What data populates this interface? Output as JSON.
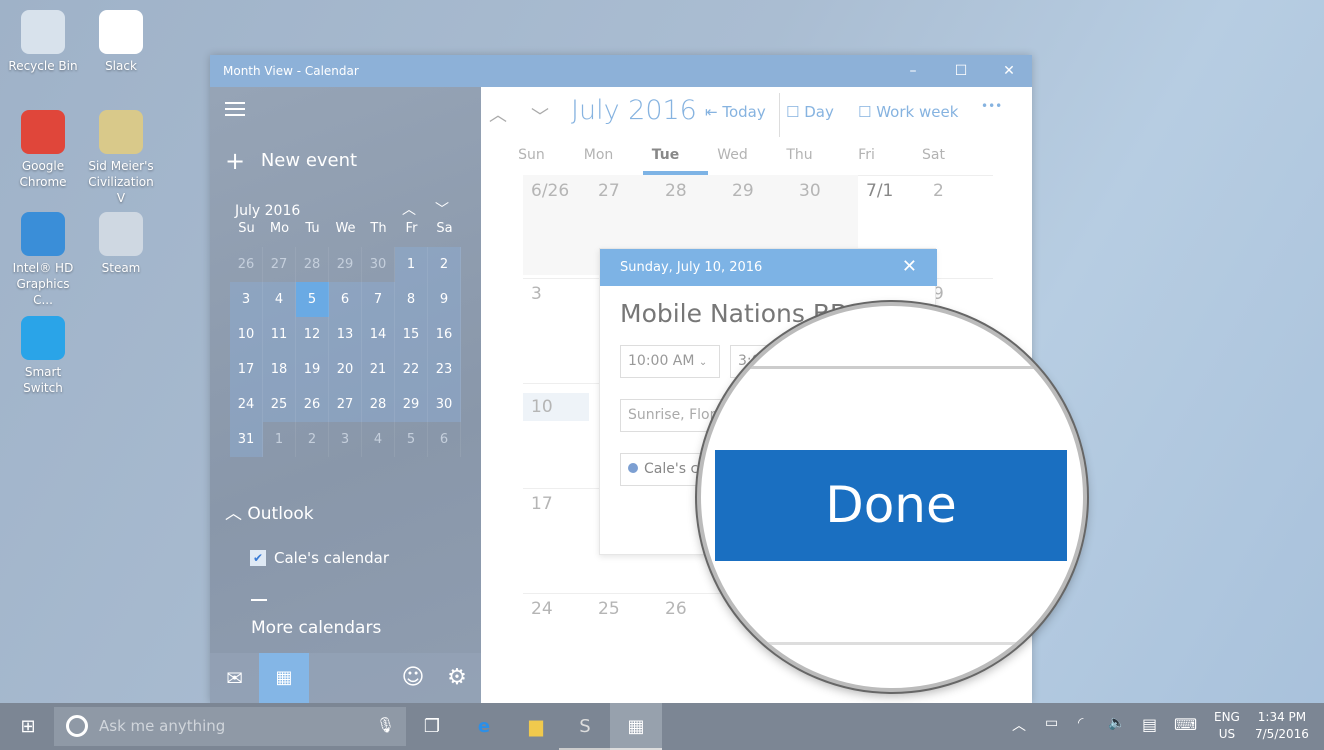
{
  "desktop": {
    "icons": [
      {
        "label": "Recycle Bin",
        "icon": "recycle-bin-icon",
        "color": "#d8e2ec"
      },
      {
        "label": "Slack",
        "icon": "slack-icon",
        "color": "#ffffff"
      },
      {
        "label": "Google Chrome",
        "icon": "chrome-icon",
        "color": "#e0463a"
      },
      {
        "label": "Sid Meier's Civilization V",
        "icon": "civilization-icon",
        "color": "#d9c98a"
      },
      {
        "label": "Intel® HD Graphics C...",
        "icon": "intel-icon",
        "color": "#3a8ed8"
      },
      {
        "label": "Steam",
        "icon": "steam-icon",
        "color": "#cfd8e2"
      },
      {
        "label": "Smart Switch",
        "icon": "smart-switch-icon",
        "color": "#2aa4e8"
      }
    ]
  },
  "window": {
    "title": "Month View - Calendar",
    "minimize": "–",
    "maximize": "☐",
    "close": "✕"
  },
  "sidebar": {
    "menu_icon": "hamburger-icon",
    "new_event": "New event",
    "mini_month": "July 2016",
    "weekdays": [
      "Su",
      "Mo",
      "Tu",
      "We",
      "Th",
      "Fr",
      "Sa"
    ],
    "weeks": [
      [
        "26",
        "27",
        "28",
        "29",
        "30",
        "1",
        "2"
      ],
      [
        "3",
        "4",
        "5",
        "6",
        "7",
        "8",
        "9"
      ],
      [
        "10",
        "11",
        "12",
        "13",
        "14",
        "15",
        "16"
      ],
      [
        "17",
        "18",
        "19",
        "20",
        "21",
        "22",
        "23"
      ],
      [
        "24",
        "25",
        "26",
        "27",
        "28",
        "29",
        "30"
      ],
      [
        "31",
        "1",
        "2",
        "3",
        "4",
        "5",
        "6"
      ]
    ],
    "today": "5",
    "account": "Outlook",
    "calendar_item": "Cale's calendar",
    "calendar_checked": true,
    "more": "More calendars"
  },
  "toolbar": {
    "month": "July 2016",
    "today": "Today",
    "day": "Day",
    "work_week": "Work week",
    "more": "•••"
  },
  "grid": {
    "weekdays": [
      "Sun",
      "Mon",
      "Tue",
      "Wed",
      "Thu",
      "Fri",
      "Sat"
    ],
    "selected_weekday": "Tue",
    "rows": [
      [
        "6/26",
        "27",
        "28",
        "29",
        "30",
        "7/1",
        "2"
      ],
      [
        "3",
        "",
        "",
        "",
        "",
        "",
        "9"
      ],
      [
        "10",
        "",
        "",
        "",
        "",
        "",
        ""
      ],
      [
        "17",
        "",
        "",
        "",
        "",
        "",
        ""
      ],
      [
        "24",
        "25",
        "26",
        "",
        "",
        "",
        ""
      ]
    ]
  },
  "popup": {
    "date": "Sunday, July 10, 2016",
    "title": "Mobile Nations BBQ",
    "start": "10:00 AM",
    "end": "3:00 PM",
    "location": "Sunrise, Florida",
    "calendar": "Cale's calendar"
  },
  "magnifier": {
    "done": "Done"
  },
  "taskbar": {
    "search_placeholder": "Ask me anything",
    "lang1": "ENG",
    "lang2": "US",
    "time": "1:34 PM",
    "date": "7/5/2016"
  },
  "colors": {
    "accent": "#1a6fc1",
    "popup_header": "#7db3e5",
    "today": "#6aaae4"
  }
}
